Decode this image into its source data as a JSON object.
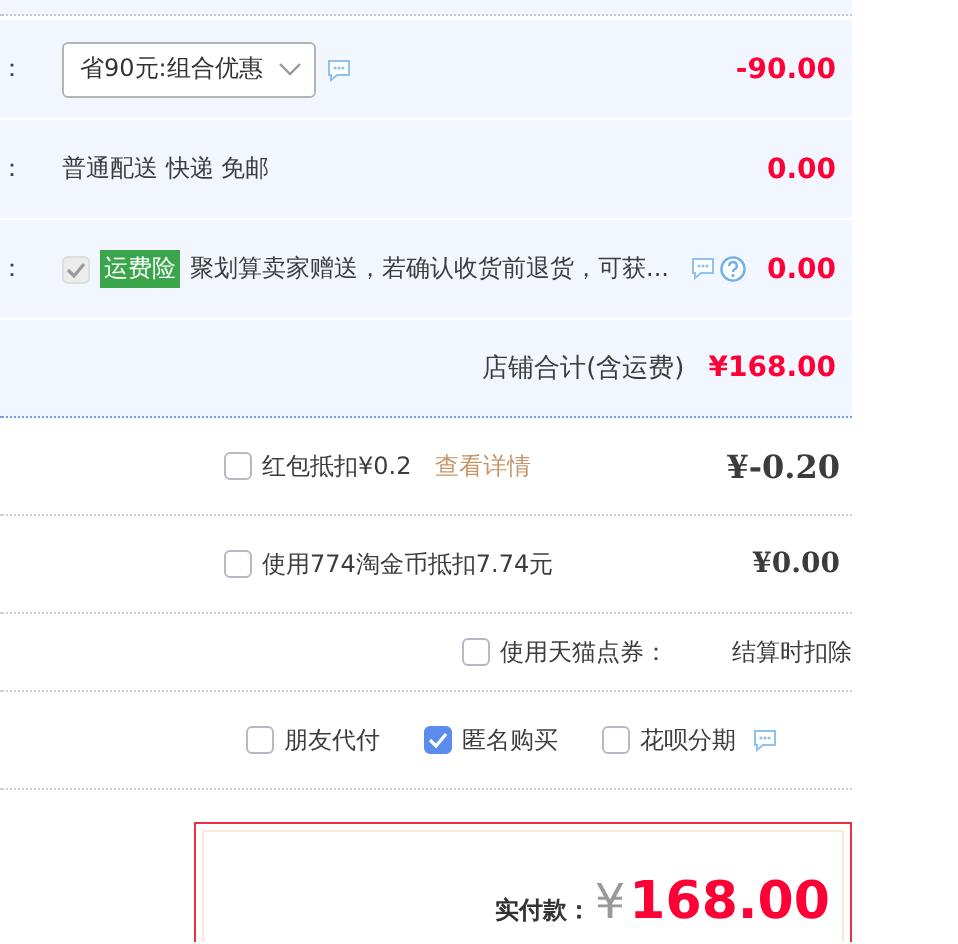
{
  "order_rows": [
    {
      "kind": "select",
      "label": "：",
      "value": "省90元:组合优惠",
      "amount": "-90.00"
    },
    {
      "kind": "text",
      "label": "：",
      "text": "普通配送 快递 免邮",
      "amount": "0.00"
    },
    {
      "kind": "insurance",
      "label": "：",
      "checked": true,
      "disabled": true,
      "badge": "运费险",
      "text": "聚划算卖家赠送，若确认收货前退货，可获...",
      "amount": "0.00"
    }
  ],
  "shop_total": {
    "label": "店铺合计(含运费)",
    "amount": "¥168.00"
  },
  "deductions": [
    {
      "kind": "link",
      "checked": false,
      "label": "红包抵扣¥0.2",
      "link": "查看详情",
      "amount": "¥-0.20"
    },
    {
      "kind": "plain",
      "checked": false,
      "label": "使用774淘金币抵扣7.74元",
      "amount": "¥0.00"
    },
    {
      "kind": "note",
      "checked": false,
      "label": "使用天猫点券：",
      "note": "结算时扣除"
    }
  ],
  "options": [
    {
      "label": "朋友代付",
      "checked": false,
      "chat_icon": false
    },
    {
      "label": "匿名购买",
      "checked": true,
      "chat_icon": false
    },
    {
      "label": "花呗分期",
      "checked": false,
      "chat_icon": true
    }
  ],
  "payment": {
    "label": "实付款：",
    "currency": "¥",
    "amount": "168.00"
  }
}
